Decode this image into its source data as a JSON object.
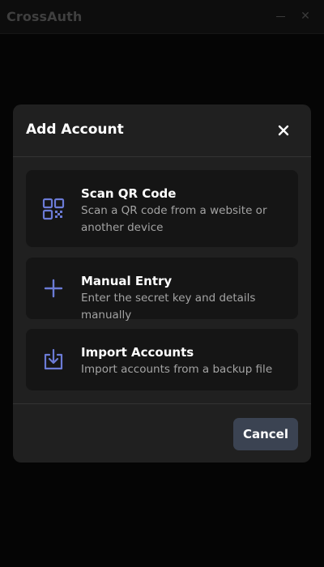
{
  "window": {
    "title": "CrossAuth",
    "minimize_icon": "minimize-icon",
    "close_icon": "close-icon"
  },
  "modal": {
    "title": "Add Account",
    "close_icon": "close-icon",
    "options": [
      {
        "icon": "qr-code-icon",
        "title": "Scan QR Code",
        "description": "Scan a QR code from a website or another device"
      },
      {
        "icon": "plus-icon",
        "title": "Manual Entry",
        "description": "Enter the secret key and details manually"
      },
      {
        "icon": "import-icon",
        "title": "Import Accounts",
        "description": "Import accounts from a backup file"
      }
    ],
    "cancel_label": "Cancel"
  },
  "colors": {
    "background": "#050505",
    "modal": "#202020",
    "card": "#151515",
    "accent_icon": "#6b7bd6",
    "cancel_button": "#3b4352",
    "muted_text": "#a3a3a3"
  }
}
